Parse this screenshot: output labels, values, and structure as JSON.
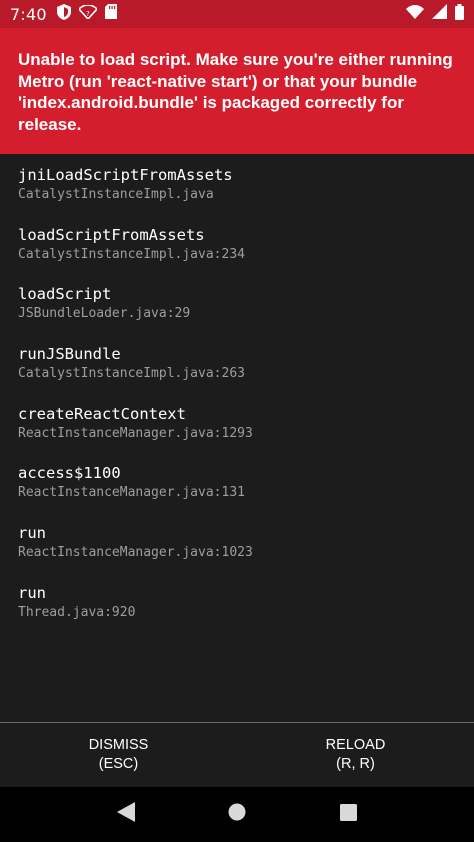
{
  "status_bar": {
    "time": "7:40",
    "left_icons": [
      "shield-icon",
      "wifi-off-icon",
      "sd-card-icon"
    ],
    "right_icons": [
      "wifi-icon",
      "signal-icon",
      "battery-icon"
    ]
  },
  "error": {
    "message": "Unable to load script. Make sure you're either running Metro (run 'react-native start') or that your bundle 'index.android.bundle' is packaged correctly for release."
  },
  "stack": [
    {
      "method": "jniLoadScriptFromAssets",
      "file": "CatalystInstanceImpl.java"
    },
    {
      "method": "loadScriptFromAssets",
      "file": "CatalystInstanceImpl.java:234"
    },
    {
      "method": "loadScript",
      "file": "JSBundleLoader.java:29"
    },
    {
      "method": "runJSBundle",
      "file": "CatalystInstanceImpl.java:263"
    },
    {
      "method": "createReactContext",
      "file": "ReactInstanceManager.java:1293"
    },
    {
      "method": "access$1100",
      "file": "ReactInstanceManager.java:131"
    },
    {
      "method": "run",
      "file": "ReactInstanceManager.java:1023"
    },
    {
      "method": "run",
      "file": "Thread.java:920"
    }
  ],
  "buttons": {
    "dismiss": {
      "label": "DISMISS",
      "shortcut": "(ESC)"
    },
    "reload": {
      "label": "RELOAD",
      "shortcut": "(R, R)"
    }
  },
  "nav": {
    "icons": [
      "back-icon",
      "home-icon",
      "recents-icon"
    ]
  },
  "colors": {
    "status_bar": "#b81a2a",
    "error_header": "#d41e2e",
    "stack_background": "#1c1c1c",
    "file_text": "#9e9e9e"
  }
}
